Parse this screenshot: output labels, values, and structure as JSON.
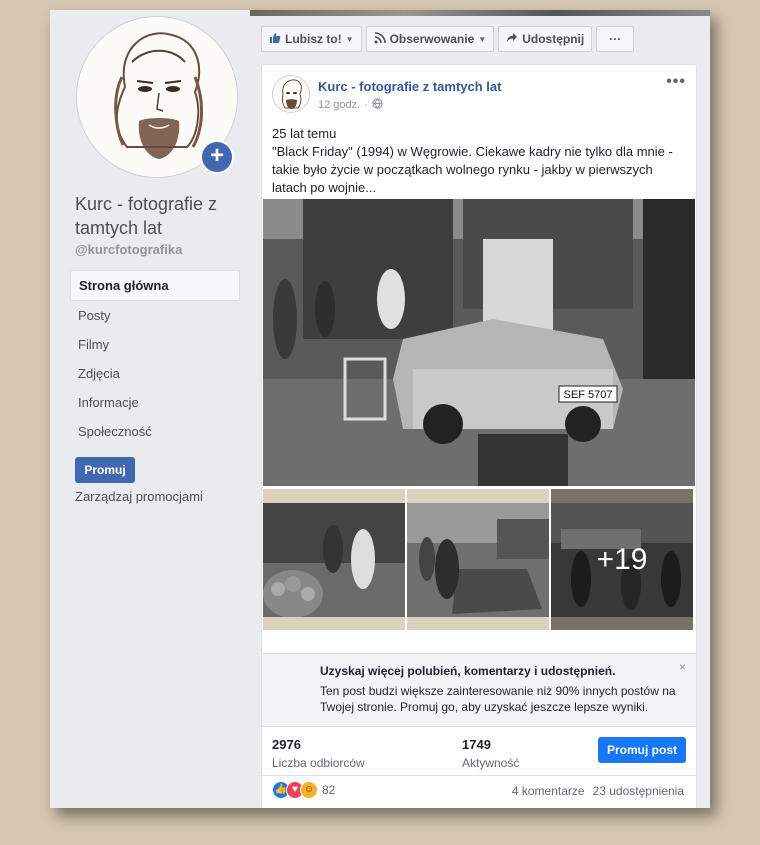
{
  "page": {
    "name": "Kurc - fotografie z tamtych lat",
    "handle": "@kurcfotografika"
  },
  "sidebar": {
    "items": [
      {
        "label": "Strona główna",
        "active": true
      },
      {
        "label": "Posty"
      },
      {
        "label": "Filmy"
      },
      {
        "label": "Zdjęcia"
      },
      {
        "label": "Informacje"
      },
      {
        "label": "Społeczność"
      }
    ],
    "promote_label": "Promuj",
    "manage_promotions_label": "Zarządzaj promocjami"
  },
  "toolbar": {
    "like_label": "Lubisz to!",
    "follow_label": "Obserwowanie",
    "share_label": "Udostępnij",
    "more_label": "···"
  },
  "post": {
    "author": "Kurc - fotografie z tamtych lat",
    "time": "12 godz.",
    "text_line1": "25 lat temu",
    "text_body": "\"Black Friday\" (1994) w Węgrowie. Ciekawe kadry nie tylko dla mnie - takie było życie w początkach wolnego rynku - jakby w pierwszych latach po wojnie...",
    "more_photos": "+19",
    "plate_text": "SEF 5707",
    "boost": {
      "title": "Uzyskaj więcej polubień, komentarzy i udostępnień.",
      "description": "Ten post budzi większe zainteresowanie niż 90% innych postów na Twojej stronie. Promuj go, aby uzyskać jeszcze lepsze wyniki.",
      "close": "×"
    },
    "stats": {
      "reach_value": "2976",
      "reach_label": "Liczba odbiorców",
      "engagement_value": "1749",
      "engagement_label": "Aktywność",
      "boost_button": "Promuj post"
    },
    "reactions_count": "82",
    "comments": "4 komentarze",
    "shares": "23 udostępnienia"
  },
  "colors": {
    "accent": "#4267b2",
    "boost_button": "#1877f2",
    "background": "#d8c7b0"
  }
}
